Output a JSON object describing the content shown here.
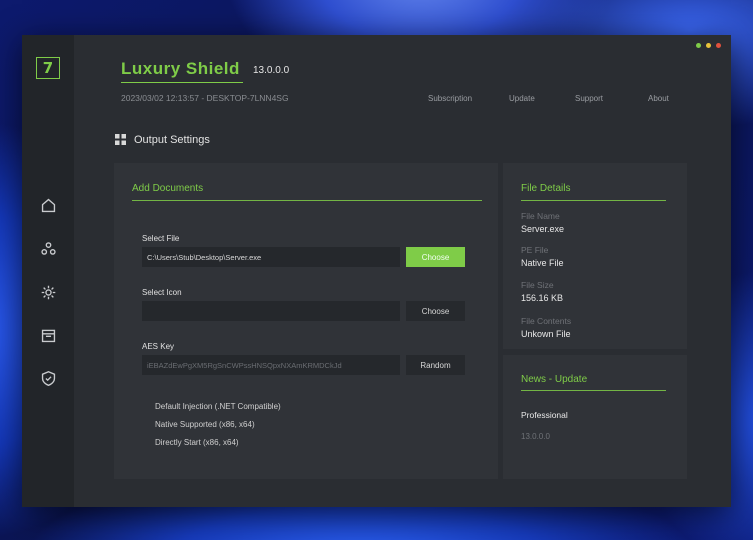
{
  "app": {
    "title": "Luxury Shield",
    "version": "13.0.0.0",
    "meta": "2023/03/02 12:13:57 - DESKTOP-7LNN4SG",
    "logo_text": "7",
    "accent_color": "#7fcc48"
  },
  "window_controls": [
    "#7fcc48",
    "#e8c23a",
    "#e0513d"
  ],
  "top_nav": {
    "subscription": "Subscription",
    "update": "Update",
    "support": "Support",
    "about": "About"
  },
  "sidebar": {
    "icons": [
      "home-icon",
      "people-icon",
      "settings-gear-icon",
      "calendar-icon",
      "shield-icon"
    ]
  },
  "section_title": "Output Settings",
  "add_documents": {
    "title": "Add Documents",
    "select_file_label": "Select File",
    "select_file_value": "C:\\Users\\Stub\\Desktop\\Server.exe",
    "select_file_button": "Choose",
    "select_icon_label": "Select Icon",
    "select_icon_value": "",
    "select_icon_button": "Choose",
    "aes_key_label": "AES Key",
    "aes_key_value": "iEBAZdEwPgXM5RgSnCWPssHNSQpxNXAmKRMDCkJd",
    "aes_key_button": "Random",
    "options": [
      "Default Injection (.NET Compatible)",
      "Native Supported (x86, x64)",
      "Directly Start (x86, x64)"
    ]
  },
  "file_details": {
    "title": "File Details",
    "file_name_label": "File Name",
    "file_name_value": "Server.exe",
    "pe_file_label": "PE File",
    "pe_file_value": "Native File",
    "file_size_label": "File Size",
    "file_size_value": "156.16 KB",
    "file_contents_label": "File Contents",
    "file_contents_value": "Unkown File"
  },
  "news": {
    "title": "News - Update",
    "edition": "Professional",
    "version": "13.0.0.0"
  }
}
